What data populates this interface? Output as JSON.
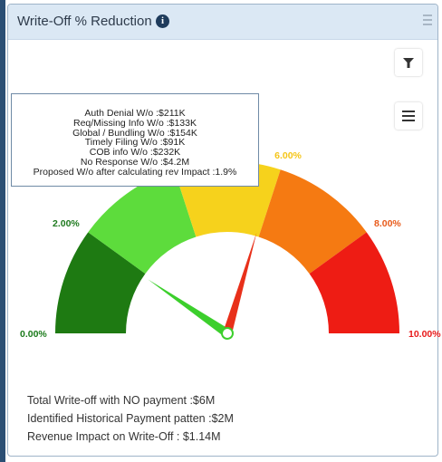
{
  "widget": {
    "title": "Write-Off % Reduction",
    "info_icon_glyph": "i"
  },
  "toolbar": {
    "filter_icon": "filter-icon",
    "menu_icon": "hamburger-menu-icon"
  },
  "tooltip": {
    "lines": [
      "Auth Denial W/o :$211K",
      "Req/Missing Info W/o :$133K",
      "Global / Bundling W/o :$154K",
      "Timely Filing W/o :$91K",
      "COB info W/o :$232K",
      "No Response W/o :$4.2M",
      "Proposed W/o after calculating rev Impact :1.9%"
    ]
  },
  "gauge": {
    "labels": [
      "0.00%",
      "2.00%",
      "6.00%",
      "8.00%",
      "10.00%"
    ],
    "label_colors": [
      "#1a7a1a",
      "#1f7a1f",
      "#f5c518",
      "#e85a1a",
      "#e8191a"
    ],
    "band_colors": [
      "#1e7a12",
      "#5ddc3c",
      "#f6d21c",
      "#f57a12",
      "#ee1c14"
    ],
    "needles": [
      {
        "color": "#3ccf2c",
        "value_percent": 1.9
      },
      {
        "color": "#e8301a",
        "value_percent": 5.9
      }
    ]
  },
  "summary": {
    "line1": "Total Write-off with NO payment :$6M",
    "line2": "Identified Historical Payment patten :$2M",
    "line3": "Revenue Impact on Write-Off : $1.14M"
  }
}
